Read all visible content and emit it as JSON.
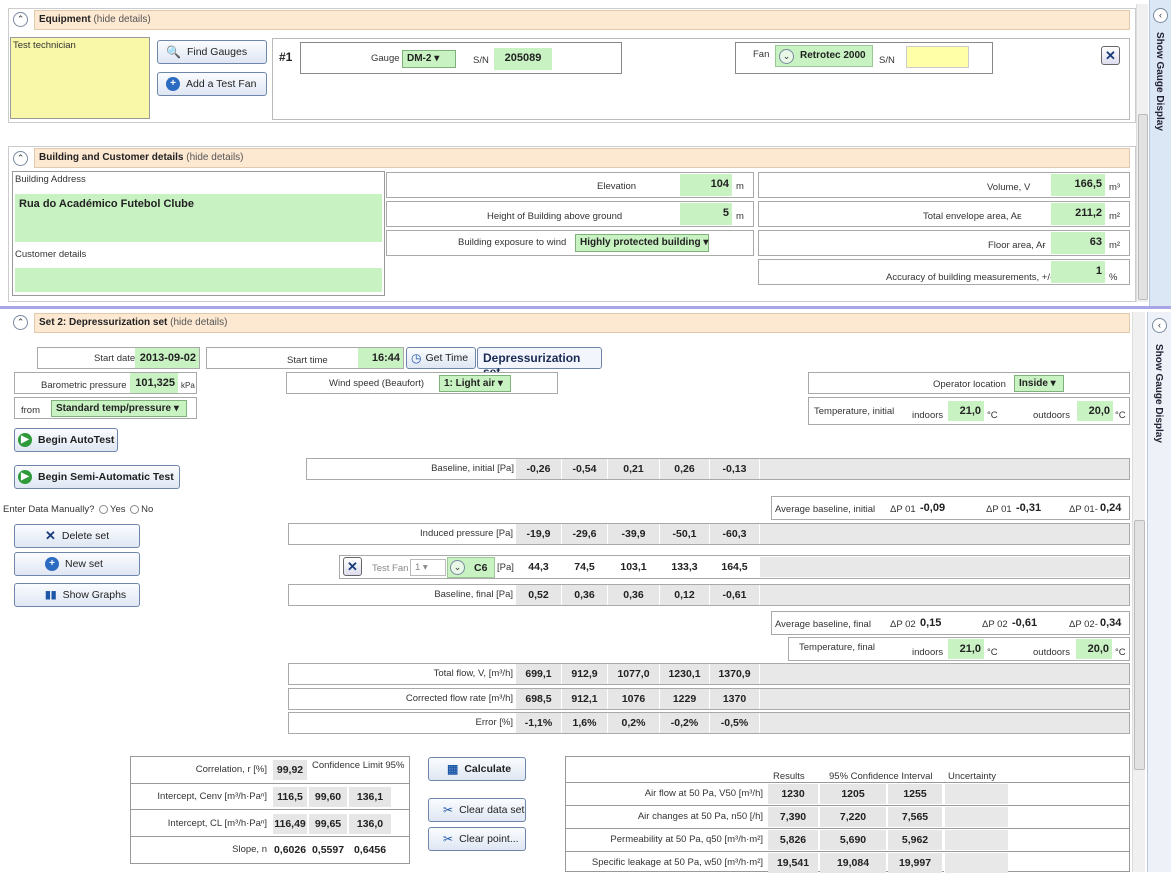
{
  "equipment": {
    "title": "Equipment",
    "hide": "(hide details)",
    "tech_label": "Test technician",
    "find_gauges": "Find Gauges",
    "add_fan": "Add a Test Fan",
    "num": "#1",
    "gauge_label": "Gauge",
    "gauge_value": "DM-2",
    "sn_label": "S/N",
    "gauge_sn": "205089",
    "fan_label": "Fan",
    "fan_value": "Retrotec 2000",
    "fan_sn_label": "S/N"
  },
  "building": {
    "title": "Building and Customer details",
    "hide": "(hide details)",
    "address_label": "Building Address",
    "address_value": "Rua do Académico Futebol Clube",
    "customer_label": "Customer details",
    "elevation_label": "Elevation",
    "elevation_value": "104",
    "elevation_unit": "m",
    "height_label": "Height of Building above ground",
    "height_value": "5",
    "height_unit": "m",
    "exposure_label": "Building exposure to wind",
    "exposure_value": "Highly protected building",
    "volume_label": "Volume, V",
    "volume_value": "166,5",
    "volume_unit": "m³",
    "envelope_label": "Total envelope area, Aᴇ",
    "envelope_value": "211,2",
    "envelope_unit": "m²",
    "floor_label": "Floor area, Aғ",
    "floor_value": "63",
    "floor_unit": "m²",
    "accuracy_label": "Accuracy of building measurements, +/-",
    "accuracy_value": "1",
    "accuracy_unit": "%"
  },
  "sidebar": {
    "label": "Show Gauge Display"
  },
  "set": {
    "title": "Set 2: Depressurization set",
    "hide": "(hide details)",
    "start_date_label": "Start date",
    "start_date": "2013-09-02",
    "start_time_label": "Start time",
    "start_time": "16:44",
    "get_time": "Get Time",
    "set_name": "Depressurization set",
    "baro_label": "Barometric pressure",
    "baro_value": "101,325",
    "baro_unit": "kPa",
    "from_label": "from",
    "from_value": "Standard temp/pressure",
    "wind_label": "Wind speed (Beaufort)",
    "wind_value": "1: Light air",
    "operator_label": "Operator location",
    "operator_value": "Inside",
    "temp_initial_label": "Temperature, initial",
    "indoors_label": "indoors",
    "indoors_value": "21,0",
    "outdoors_label": "outdoors",
    "outdoors_value": "20,0",
    "deg_unit": "°C",
    "begin_auto": "Begin AutoTest",
    "begin_semi": "Begin Semi-Automatic Test",
    "enter_manual": "Enter Data Manually?",
    "yes": "Yes",
    "no": "No",
    "delete_set": "Delete set",
    "new_set": "New set",
    "show_graphs": "Show Graphs",
    "baseline_initial_label": "Baseline, initial [Pa]",
    "baseline_initial": [
      "-0,26",
      "-0,54",
      "0,21",
      "0,26",
      "-0,13"
    ],
    "avg_baseline_initial_label": "Average baseline, initial",
    "dp01_label": "ΔP 01",
    "dp01_value": "-0,09",
    "dp01p_label": "ΔP 01",
    "dp01p_value": "-0,31",
    "dp01m_label": "ΔP 01-",
    "dp01m_value": "0,24",
    "induced_label": "Induced pressure [Pa]",
    "induced": [
      "-19,9",
      "-29,6",
      "-39,9",
      "-50,1",
      "-60,3"
    ],
    "test_fan_label": "Test Fan",
    "test_fan_num": "1",
    "test_fan_ring": "C6",
    "pa_unit": "[Pa]",
    "fan_pressure": [
      "44,3",
      "74,5",
      "103,1",
      "133,3",
      "164,5"
    ],
    "baseline_final_label": "Baseline, final [Pa]",
    "baseline_final": [
      "0,52",
      "0,36",
      "0,36",
      "0,12",
      "-0,61"
    ],
    "avg_baseline_final_label": "Average baseline, final",
    "dp02_label": "ΔP 02",
    "dp02_value": "0,15",
    "dp02p_label": "ΔP 02",
    "dp02p_value": "-0,61",
    "dp02m_label": "ΔP 02-",
    "dp02m_value": "0,34",
    "temp_final_label": "Temperature, final",
    "indoors_final": "21,0",
    "outdoors_final": "20,0",
    "total_flow_label": "Total flow, V, [m³/h]",
    "total_flow": [
      "699,1",
      "912,9",
      "1077,0",
      "1230,1",
      "1370,9"
    ],
    "corrected_label": "Corrected flow rate [m³/h]",
    "corrected": [
      "698,5",
      "912,1",
      "1076",
      "1229",
      "1370"
    ],
    "error_label": "Error [%]",
    "error": [
      "-1,1%",
      "1,6%",
      "0,2%",
      "-0,2%",
      "-0,5%"
    ]
  },
  "stats": {
    "correlation_label": "Correlation, r [%]",
    "correlation": "99,92",
    "conf_label": "Confidence Limit 95%",
    "cenv_label": "Intercept, Cenv [m³/h·Paⁿ]",
    "cenv": [
      "116,5",
      "99,60",
      "136,1"
    ],
    "cl_label": "Intercept, CL [m³/h·Paⁿ]",
    "cl": [
      "116,49",
      "99,65",
      "136,0"
    ],
    "slope_label": "Slope, n",
    "slope": [
      "0,6026",
      "0,5597",
      "0,6456"
    ],
    "calculate": "Calculate",
    "clear_data": "Clear data set",
    "clear_point": "Clear point..."
  },
  "results": {
    "h_results": "Results",
    "h_ci": "95% Confidence Interval",
    "h_unc": "Uncertainty",
    "rows": [
      {
        "label": "Air flow at 50 Pa, V50 [m³/h]",
        "v": [
          "1230",
          "1205",
          "1255"
        ]
      },
      {
        "label": "Air changes at 50 Pa, n50 [/h]",
        "v": [
          "7,390",
          "7,220",
          "7,565"
        ]
      },
      {
        "label": "Permeability at 50 Pa, q50 [m³/h·m²]",
        "v": [
          "5,826",
          "5,690",
          "5,962"
        ]
      },
      {
        "label": "Specific leakage at 50 Pa, w50 [m³/h·m²]",
        "v": [
          "19,541",
          "19,084",
          "19,997"
        ]
      }
    ]
  }
}
